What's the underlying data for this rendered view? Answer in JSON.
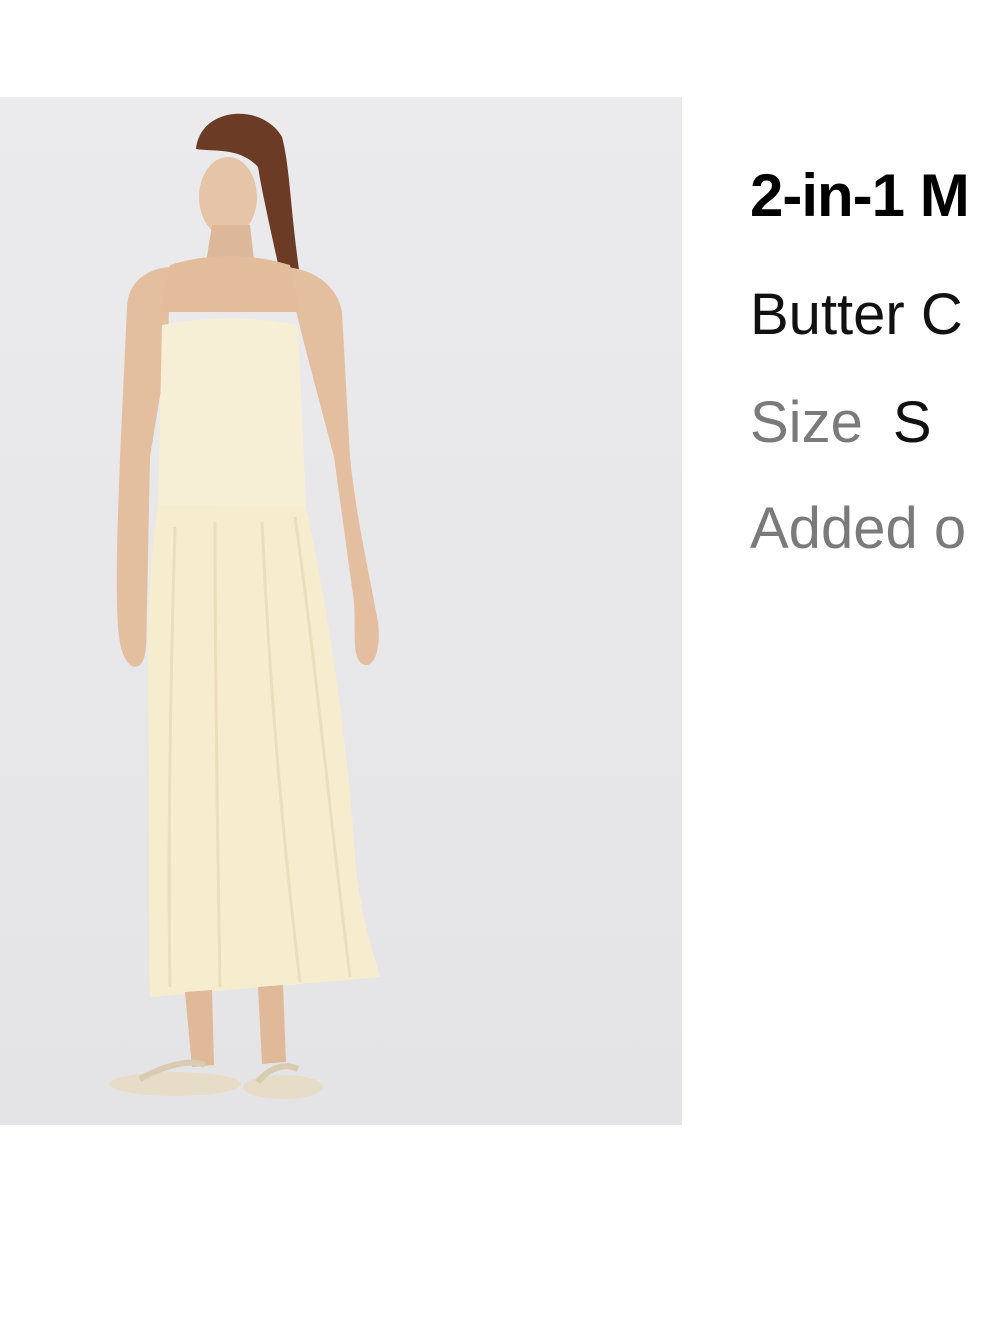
{
  "product": {
    "image_alt": "Model wearing cream strapless maxi dress",
    "title": "2-in-1 M",
    "color": "Butter C",
    "size_label": "Size",
    "size_value": "S",
    "added": "Added o"
  },
  "colors": {
    "background": "#ffffff",
    "image_background": "#e9e9eb",
    "dress": "#f6ecce",
    "secondary_text": "#7a7a7a"
  }
}
